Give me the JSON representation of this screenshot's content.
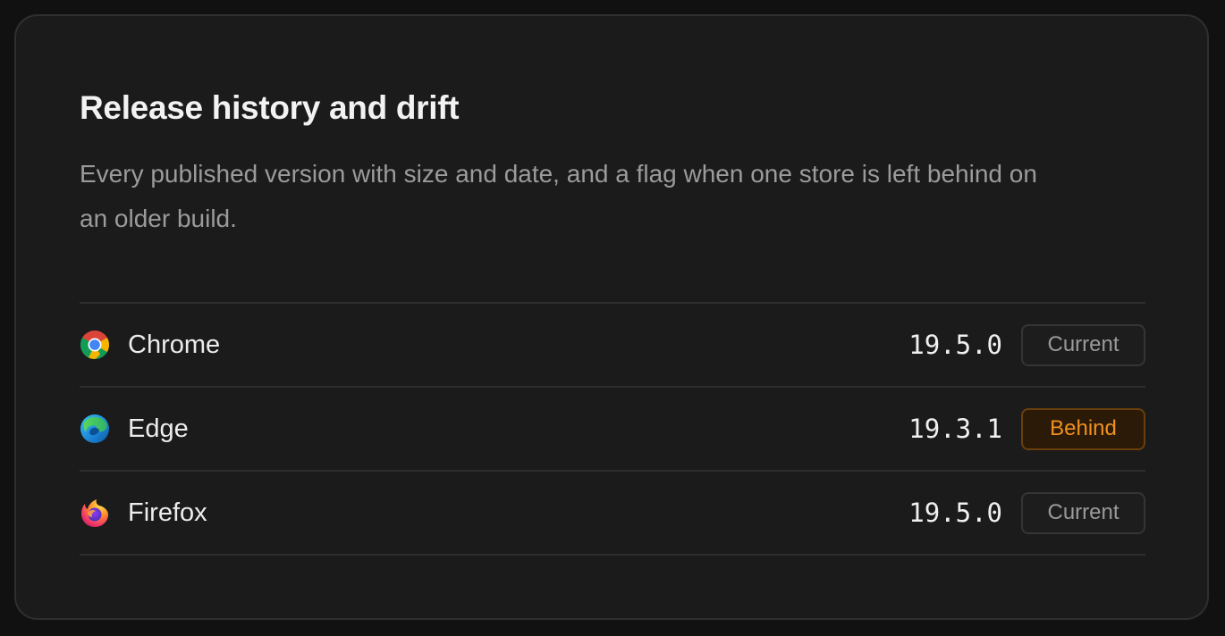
{
  "card": {
    "title": "Release history and drift",
    "description": "Every published version with size and date, and a flag when one store is left behind on an older build."
  },
  "rows": [
    {
      "icon": "chrome-icon",
      "name": "Chrome",
      "version": "19.5.0",
      "status": "Current"
    },
    {
      "icon": "edge-icon",
      "name": "Edge",
      "version": "19.3.1",
      "status": "Behind"
    },
    {
      "icon": "firefox-icon",
      "name": "Firefox",
      "version": "19.5.0",
      "status": "Current"
    }
  ],
  "colors": {
    "background": "#111111",
    "card": "#1b1b1b",
    "behind_accent": "#f0901f",
    "current_text": "#9a9a9a"
  }
}
